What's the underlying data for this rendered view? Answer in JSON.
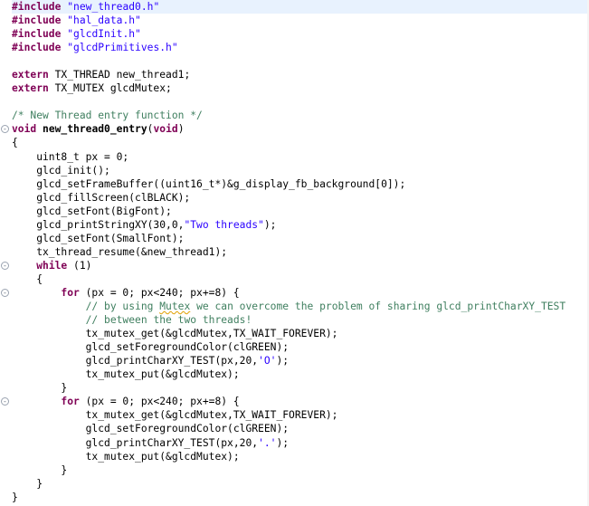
{
  "editor": {
    "lines": [
      {
        "t": [
          [
            "pp",
            "#include"
          ],
          [
            "n",
            " "
          ],
          [
            "str",
            "\"new_thread0.h\""
          ]
        ],
        "current": true
      },
      {
        "t": [
          [
            "pp",
            "#include"
          ],
          [
            "n",
            " "
          ],
          [
            "str",
            "\"hal_data.h\""
          ]
        ]
      },
      {
        "t": [
          [
            "pp",
            "#include"
          ],
          [
            "n",
            " "
          ],
          [
            "str",
            "\"glcdInit.h\""
          ]
        ]
      },
      {
        "t": [
          [
            "pp",
            "#include"
          ],
          [
            "n",
            " "
          ],
          [
            "str",
            "\"glcdPrimitives.h\""
          ]
        ]
      },
      {
        "t": []
      },
      {
        "t": [
          [
            "kw",
            "extern"
          ],
          [
            "n",
            " TX_THREAD new_thread1;"
          ]
        ]
      },
      {
        "t": [
          [
            "kw",
            "extern"
          ],
          [
            "n",
            " TX_MUTEX glcdMutex;"
          ]
        ]
      },
      {
        "t": []
      },
      {
        "t": [
          [
            "cmt",
            "/* New Thread entry function */"
          ]
        ]
      },
      {
        "t": [
          [
            "kw",
            "void"
          ],
          [
            "n",
            " "
          ],
          [
            "fn",
            "new_thread0_entry"
          ],
          [
            "n",
            "("
          ],
          [
            "kw",
            "void"
          ],
          [
            "n",
            ")"
          ]
        ],
        "fold": "-"
      },
      {
        "t": [
          [
            "n",
            "{"
          ]
        ]
      },
      {
        "t": [
          [
            "n",
            "    uint8_t px = 0;"
          ]
        ]
      },
      {
        "t": [
          [
            "n",
            "    glcd_init();"
          ]
        ]
      },
      {
        "t": [
          [
            "n",
            "    glcd_setFrameBuffer((uint16_t*)&g_display_fb_background[0]);"
          ]
        ]
      },
      {
        "t": [
          [
            "n",
            "    glcd_fillScreen(clBLACK);"
          ]
        ]
      },
      {
        "t": [
          [
            "n",
            "    glcd_setFont(BigFont);"
          ]
        ]
      },
      {
        "t": [
          [
            "n",
            "    glcd_printStringXY(30,0,"
          ],
          [
            "str",
            "\"Two threads\""
          ],
          [
            "n",
            ");"
          ]
        ]
      },
      {
        "t": [
          [
            "n",
            "    glcd_setFont(SmallFont);"
          ]
        ]
      },
      {
        "t": [
          [
            "n",
            "    tx_thread_resume(&new_thread1);"
          ]
        ]
      },
      {
        "t": [
          [
            "n",
            "    "
          ],
          [
            "kw",
            "while"
          ],
          [
            "n",
            " (1)"
          ]
        ],
        "fold": "-"
      },
      {
        "t": [
          [
            "n",
            "    {"
          ]
        ]
      },
      {
        "t": [
          [
            "n",
            "        "
          ],
          [
            "kw",
            "for"
          ],
          [
            "n",
            " (px = 0; px<240; px+=8) {"
          ]
        ],
        "fold": "-"
      },
      {
        "t": [
          [
            "n",
            "            "
          ],
          [
            "cmt",
            "// by using "
          ],
          [
            "cmtsq",
            "Mutex"
          ],
          [
            "cmt",
            " we can overcome the problem of sharing glcd_printCharXY_TEST"
          ]
        ]
      },
      {
        "t": [
          [
            "n",
            "            "
          ],
          [
            "cmt",
            "// between the two threads!"
          ]
        ]
      },
      {
        "t": [
          [
            "n",
            "            tx_mutex_get(&glcdMutex,TX_WAIT_FOREVER);"
          ]
        ]
      },
      {
        "t": [
          [
            "n",
            "            glcd_setForegroundColor(clGREEN);"
          ]
        ]
      },
      {
        "t": [
          [
            "n",
            "            glcd_printCharXY_TEST(px,20,"
          ],
          [
            "str",
            "'O'"
          ],
          [
            "n",
            ");"
          ]
        ]
      },
      {
        "t": [
          [
            "n",
            "            tx_mutex_put(&glcdMutex);"
          ]
        ]
      },
      {
        "t": [
          [
            "n",
            "        }"
          ]
        ]
      },
      {
        "t": [
          [
            "n",
            "        "
          ],
          [
            "kw",
            "for"
          ],
          [
            "n",
            " (px = 0; px<240; px+=8) {"
          ]
        ],
        "fold": "-"
      },
      {
        "t": [
          [
            "n",
            "            tx_mutex_get(&glcdMutex,TX_WAIT_FOREVER);"
          ]
        ]
      },
      {
        "t": [
          [
            "n",
            "            glcd_setForegroundColor(clGREEN);"
          ]
        ]
      },
      {
        "t": [
          [
            "n",
            "            glcd_printCharXY_TEST(px,20,"
          ],
          [
            "str",
            "'.'"
          ],
          [
            "n",
            ");"
          ]
        ]
      },
      {
        "t": [
          [
            "n",
            "            tx_mutex_put(&glcdMutex);"
          ]
        ]
      },
      {
        "t": [
          [
            "n",
            "        }"
          ]
        ]
      },
      {
        "t": [
          [
            "n",
            "    }"
          ]
        ]
      },
      {
        "t": [
          [
            "n",
            "}"
          ]
        ]
      }
    ]
  },
  "colors": {
    "keyword": "#7f0055",
    "string": "#2a00ff",
    "comment": "#3f7f5f",
    "current_line": "#e8f2fe"
  }
}
